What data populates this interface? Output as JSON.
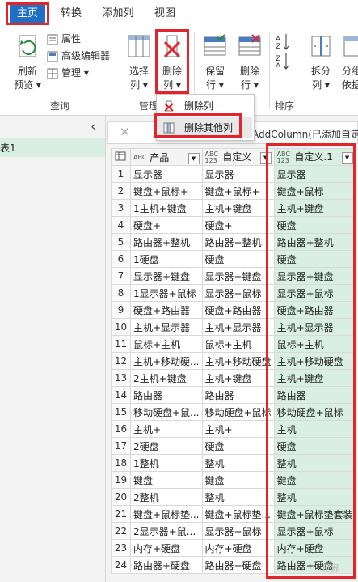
{
  "tabs": [
    "主页",
    "转换",
    "添加列",
    "视图"
  ],
  "ribbon": {
    "refresh_label": [
      "刷新",
      "预览 ▾"
    ],
    "properties_label": "属性",
    "advanced_editor_label": "高级编辑器",
    "manage_label": "管理 ▾",
    "query_group_label": "查询",
    "choose_cols_label": [
      "选择",
      "列 ▾"
    ],
    "remove_cols_label": [
      "删除",
      "列 ▾"
    ],
    "manage_group_label": "管理",
    "keep_rows_label": [
      "保留",
      "行 ▾"
    ],
    "remove_rows_label": [
      "删除",
      "行 ▾"
    ],
    "sort_group_label": "排序",
    "split_label": [
      "拆分",
      "列 ▾"
    ],
    "group_label": [
      "分组",
      "依据"
    ]
  },
  "dropdown": {
    "item1": "删除列",
    "item2": "删除其他列"
  },
  "left_panel": {
    "query_item": "表1",
    "collapse_glyph": "‹"
  },
  "formula_bar": {
    "cancel_glyph": "✕",
    "formula": "AddColumn(已添加自定义"
  },
  "grid": {
    "columns": [
      {
        "type": "ABC",
        "name": "产品"
      },
      {
        "type": "ABC 123",
        "name": "自定义"
      },
      {
        "type": "ABC 123",
        "name": "自定义.1"
      }
    ],
    "rows": [
      [
        "1",
        "显示器",
        "显示器",
        "显示器"
      ],
      [
        "2",
        "键盘+鼠标+",
        "键盘+鼠标+",
        "键盘+鼠标"
      ],
      [
        "3",
        "1主机+键盘",
        "主机+键盘",
        "主机+键盘"
      ],
      [
        "4",
        "硬盘+",
        "硬盘+",
        "硬盘"
      ],
      [
        "5",
        "路由器+整机",
        "路由器+整机",
        "路由器+整机"
      ],
      [
        "6",
        "1硬盘",
        "硬盘",
        "硬盘"
      ],
      [
        "7",
        "显示器+键盘",
        "显示器+键盘",
        "显示器+键盘"
      ],
      [
        "8",
        "1显示器+鼠标",
        "显示器+鼠标",
        "显示器+鼠标"
      ],
      [
        "9",
        "硬盘+路由器",
        "硬盘+路由器",
        "硬盘+路由器"
      ],
      [
        "10",
        "主机+显示器",
        "主机+显示器",
        "主机+显示器"
      ],
      [
        "11",
        "鼠标+主机",
        "鼠标+主机",
        "鼠标+主机"
      ],
      [
        "12",
        "主机+移动硬...",
        "主机+移动硬盘",
        "主机+移动硬盘"
      ],
      [
        "13",
        "2主机+键盘",
        "主机+键盘",
        "主机+键盘"
      ],
      [
        "14",
        "路由器",
        "路由器",
        "路由器"
      ],
      [
        "15",
        "移动硬盘+鼠...",
        "移动硬盘+鼠标",
        "移动硬盘+鼠标"
      ],
      [
        "16",
        "主机+",
        "主机+",
        "主机"
      ],
      [
        "17",
        "2硬盘",
        "硬盘",
        "硬盘"
      ],
      [
        "18",
        "1整机",
        "整机",
        "整机"
      ],
      [
        "19",
        "键盘",
        "键盘",
        "键盘"
      ],
      [
        "20",
        "2整机",
        "整机",
        "整机"
      ],
      [
        "21",
        "键盘+鼠标垫...",
        "键盘+鼠标垫...",
        "键盘+鼠标垫套装"
      ],
      [
        "22",
        "2显示器+鼠...",
        "显示器+鼠标",
        "显示器+鼠标"
      ],
      [
        "23",
        "内存+硬盘",
        "内存+硬盘",
        "内存+硬盘"
      ],
      [
        "24",
        "路由器+硬盘",
        "路由器+硬盘",
        "路由器+硬盘"
      ]
    ]
  },
  "watermark": "世界",
  "colors": {
    "accent": "#1f6fc5",
    "highlight": "#e3242b",
    "selected_col": "#d9efe3"
  }
}
